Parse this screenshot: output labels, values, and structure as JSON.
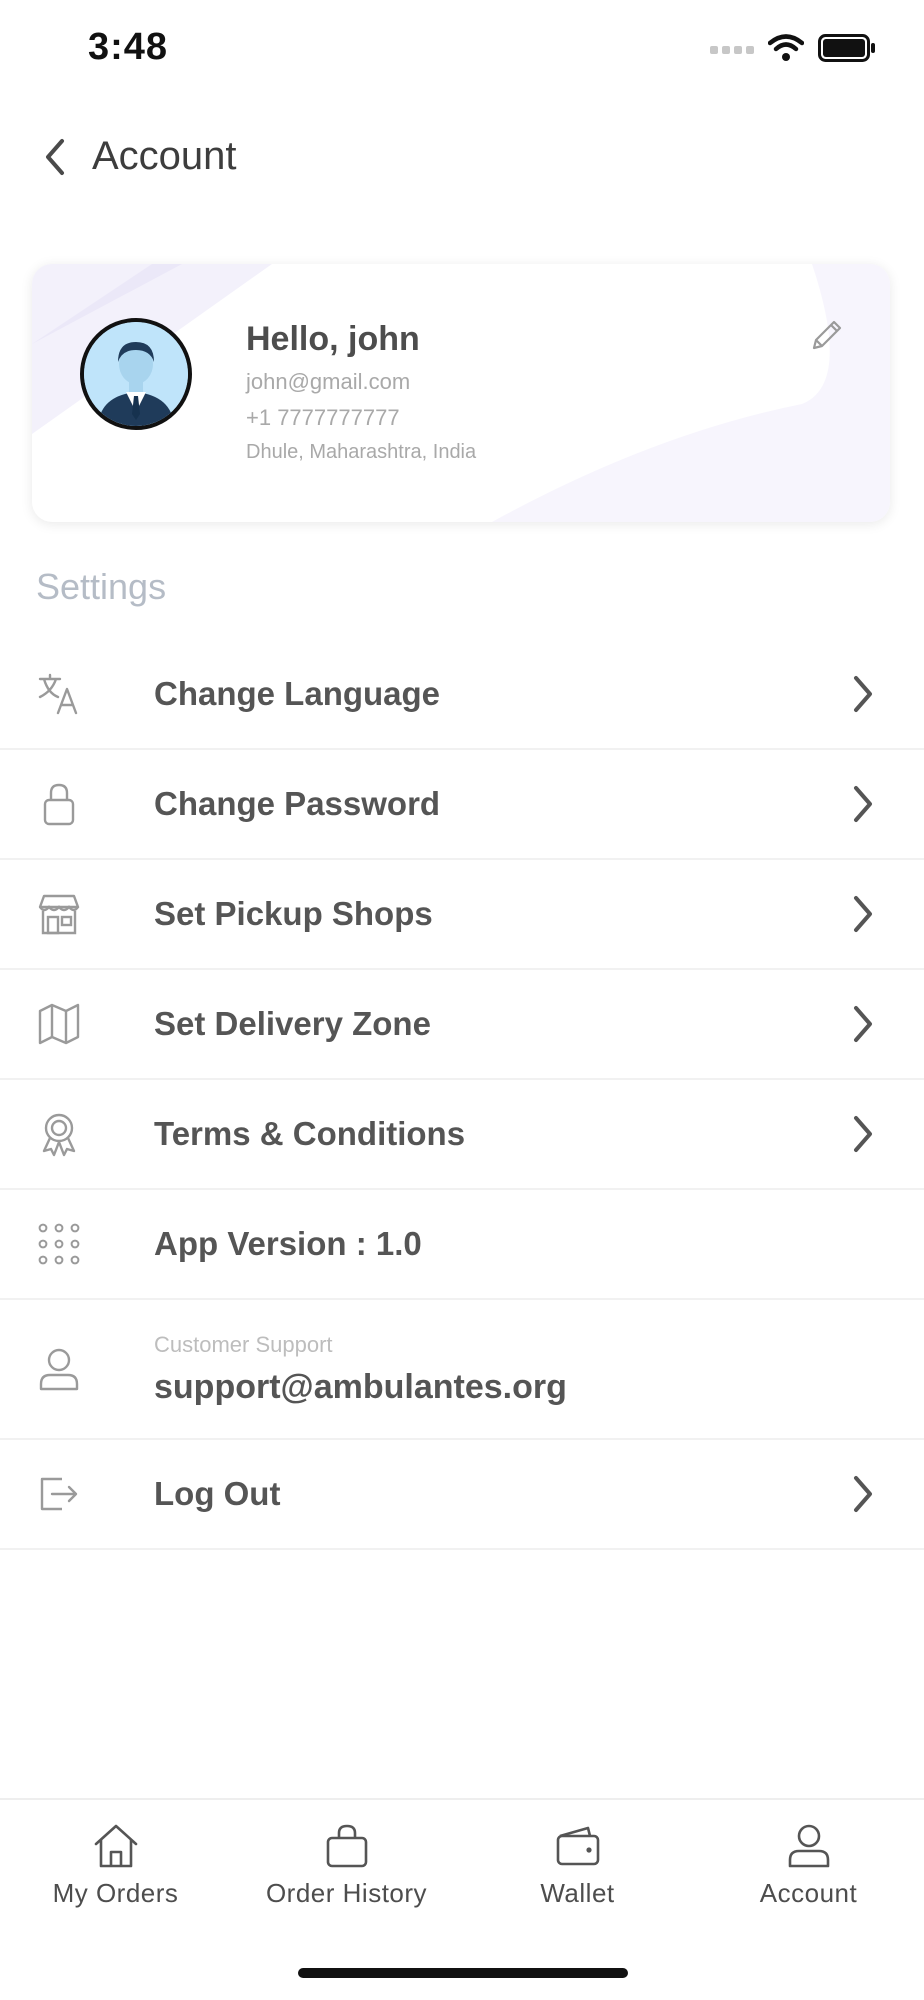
{
  "status_bar": {
    "time": "3:48"
  },
  "header": {
    "title": "Account",
    "back_icon": "chevron-left-icon"
  },
  "profile": {
    "greeting": "Hello, john",
    "email": "john@gmail.com",
    "phone": "+1 7777777777",
    "location": "Dhule, Maharashtra, India",
    "edit_icon": "pencil-icon"
  },
  "settings": {
    "title": "Settings",
    "items": [
      {
        "label": "Change Language",
        "icon": "translate-icon",
        "chevron": true
      },
      {
        "label": "Change Password",
        "icon": "lock-icon",
        "chevron": true
      },
      {
        "label": "Set Pickup Shops",
        "icon": "store-icon",
        "chevron": true
      },
      {
        "label": "Set Delivery Zone",
        "icon": "map-icon",
        "chevron": true
      },
      {
        "label": "Terms & Conditions",
        "icon": "award-icon",
        "chevron": true
      },
      {
        "label": "App Version : 1.0",
        "icon": "grid-dots-icon",
        "chevron": false
      },
      {
        "caption": "Customer Support",
        "label": "support@ambulantes.org",
        "icon": "user-icon",
        "chevron": false
      },
      {
        "label": "Log Out",
        "icon": "logout-icon",
        "chevron": true
      }
    ]
  },
  "bottom_nav": {
    "items": [
      {
        "label": "My Orders",
        "icon": "home-icon"
      },
      {
        "label": "Order History",
        "icon": "bag-icon"
      },
      {
        "label": "Wallet",
        "icon": "wallet-icon"
      },
      {
        "label": "Account",
        "icon": "user-icon"
      }
    ]
  },
  "colors": {
    "text": "#555555",
    "muted": "#a9a9a9",
    "settings_title": "#b5bcc6",
    "divider": "#f1f1f1"
  }
}
